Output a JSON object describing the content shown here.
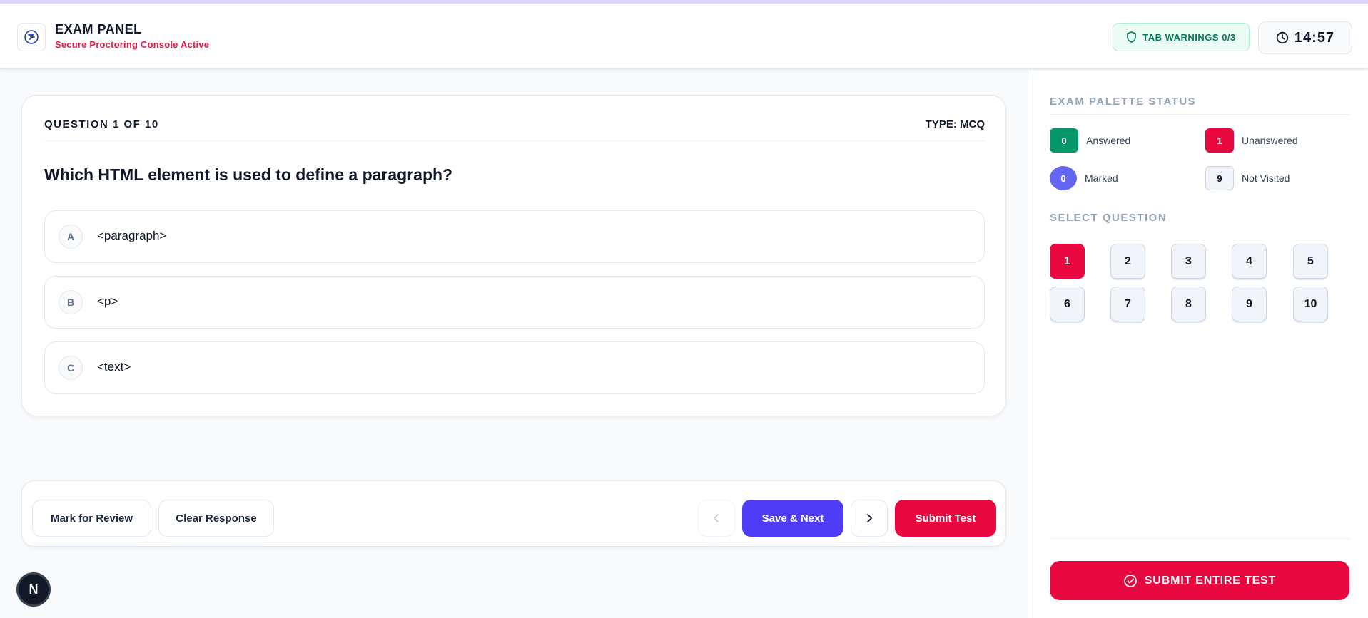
{
  "header": {
    "title": "EXAM PANEL",
    "subtitle": "Secure Proctoring Console Active",
    "tab_warnings": "TAB WARNINGS 0/3",
    "timer": "14:57"
  },
  "question": {
    "counter": "QUESTION 1 OF 10",
    "type": "TYPE: MCQ",
    "text": "Which HTML element is used to define a paragraph?",
    "options": [
      {
        "letter": "A",
        "text": "<paragraph>"
      },
      {
        "letter": "B",
        "text": "<p>"
      },
      {
        "letter": "C",
        "text": "<text>"
      }
    ]
  },
  "actions": {
    "mark_review": "Mark for Review",
    "clear_response": "Clear Response",
    "save_next": "Save & Next",
    "submit_test": "Submit Test"
  },
  "sidebar": {
    "palette_title": "EXAM PALETTE STATUS",
    "legend": [
      {
        "count": "0",
        "label": "Answered",
        "color": "#059669"
      },
      {
        "count": "1",
        "label": "Unanswered",
        "color": "#e8073f"
      },
      {
        "count": "0",
        "label": "Marked",
        "color": "#6366f1"
      },
      {
        "count": "9",
        "label": "Not Visited",
        "color": "#f1f5f9"
      }
    ],
    "select_title": "SELECT QUESTION",
    "questions": [
      "1",
      "2",
      "3",
      "4",
      "5",
      "6",
      "7",
      "8",
      "9",
      "10"
    ],
    "current_question": "1",
    "submit_all": "SUBMIT ENTIRE TEST"
  },
  "misc": {
    "badge_letter": "N"
  }
}
